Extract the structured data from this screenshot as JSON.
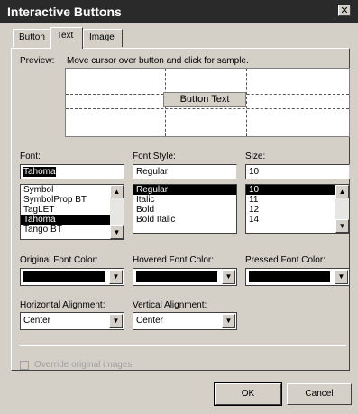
{
  "window": {
    "title": "Interactive Buttons",
    "close_glyph": "✕"
  },
  "tabs": [
    {
      "label": "Button"
    },
    {
      "label": "Text"
    },
    {
      "label": "Image"
    }
  ],
  "preview": {
    "label": "Preview:",
    "hint": "Move cursor over button and click for sample.",
    "button_text": "Button Text"
  },
  "font": {
    "label": "Font:",
    "value": "Tahoma",
    "items": [
      "Symbol",
      "SymbolProp BT",
      "TagLET",
      "Tahoma",
      "Tango BT"
    ],
    "selected_index": 3
  },
  "font_style": {
    "label": "Font Style:",
    "value": "Regular",
    "items": [
      "Regular",
      "Italic",
      "Bold",
      "Bold Italic"
    ],
    "selected_index": 0
  },
  "size": {
    "label": "Size:",
    "value": "10",
    "items": [
      "10",
      "11",
      "12",
      "14"
    ],
    "selected_index": 0
  },
  "colors": {
    "original_label": "Original Font Color:",
    "hovered_label": "Hovered Font Color:",
    "pressed_label": "Pressed Font Color:",
    "original_value": "#000000",
    "hovered_value": "#000000",
    "pressed_value": "#000000"
  },
  "alignment": {
    "horizontal_label": "Horizontal Alignment:",
    "horizontal_value": "Center",
    "vertical_label": "Vertical Alignment:",
    "vertical_value": "Center"
  },
  "override": {
    "label": "Override original images",
    "checked": false
  },
  "footer": {
    "ok_label": "OK",
    "cancel_label": "Cancel"
  }
}
